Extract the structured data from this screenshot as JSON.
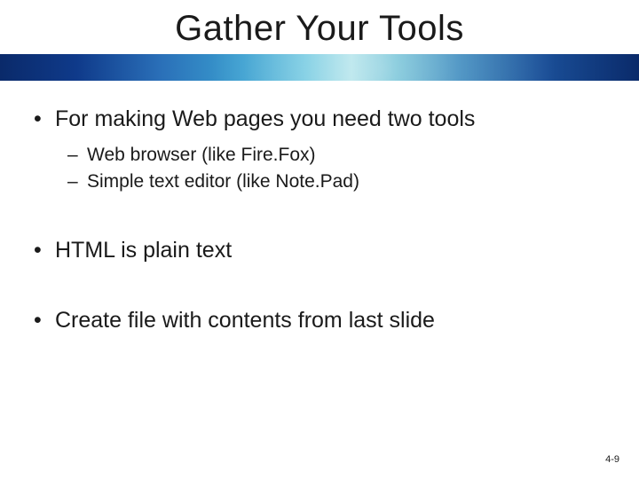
{
  "slide": {
    "title": "Gather Your Tools",
    "bullets": [
      {
        "text": "For making Web pages you need two tools",
        "sub": [
          "Web browser (like Fire.Fox)",
          "Simple text editor (like Note.Pad)"
        ]
      },
      {
        "text": "HTML is plain text"
      },
      {
        "text": "Create file with contents from last slide"
      }
    ],
    "pagenum": "4-9"
  }
}
